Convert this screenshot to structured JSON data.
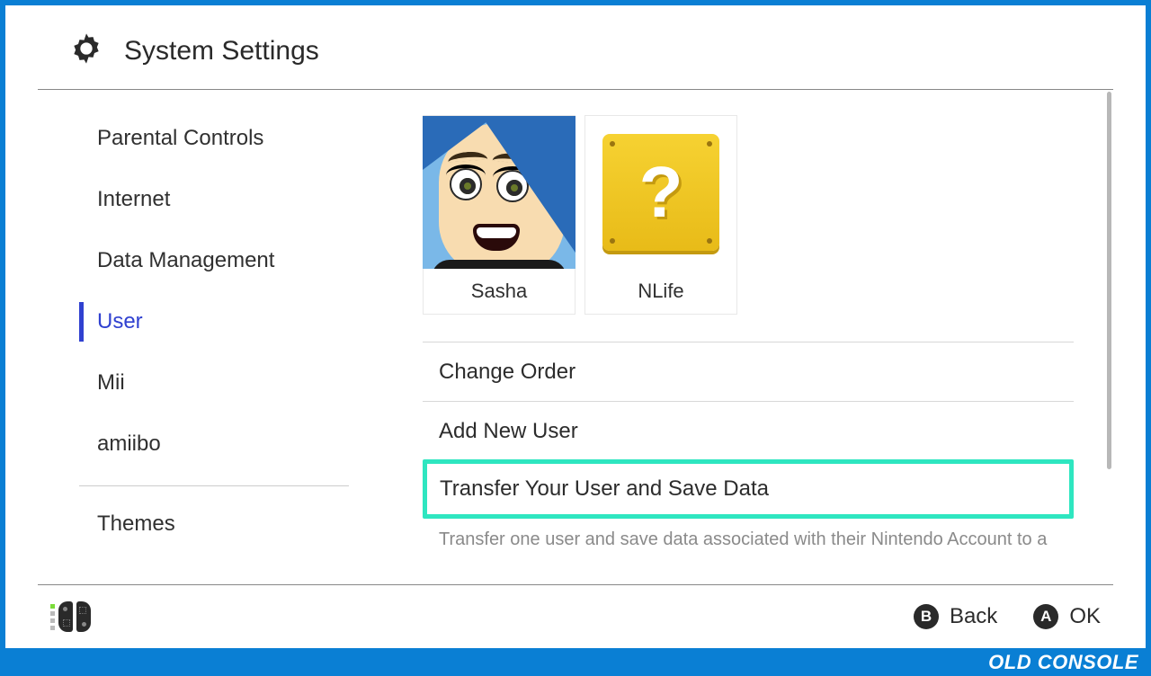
{
  "header": {
    "title": "System Settings"
  },
  "sidebar": {
    "items": [
      {
        "label": "Parental Controls",
        "active": false
      },
      {
        "label": "Internet",
        "active": false
      },
      {
        "label": "Data Management",
        "active": false
      },
      {
        "label": "User",
        "active": true
      },
      {
        "label": "Mii",
        "active": false
      },
      {
        "label": "amiibo",
        "active": false
      },
      {
        "label": "Themes",
        "active": false
      }
    ]
  },
  "main": {
    "users": [
      {
        "name": "Sasha",
        "avatar": "mii-sasha"
      },
      {
        "name": "NLife",
        "avatar": "question-block"
      }
    ],
    "options": [
      {
        "label": "Change Order",
        "highlighted": false
      },
      {
        "label": "Add New User",
        "highlighted": false
      },
      {
        "label": "Transfer Your User and Save Data",
        "highlighted": true
      }
    ],
    "description": "Transfer one user and save data associated with their Nintendo Account to a nearby console."
  },
  "footer": {
    "back": {
      "button": "B",
      "label": "Back"
    },
    "ok": {
      "button": "A",
      "label": "OK"
    }
  },
  "watermark": "OLD CONSOLE"
}
